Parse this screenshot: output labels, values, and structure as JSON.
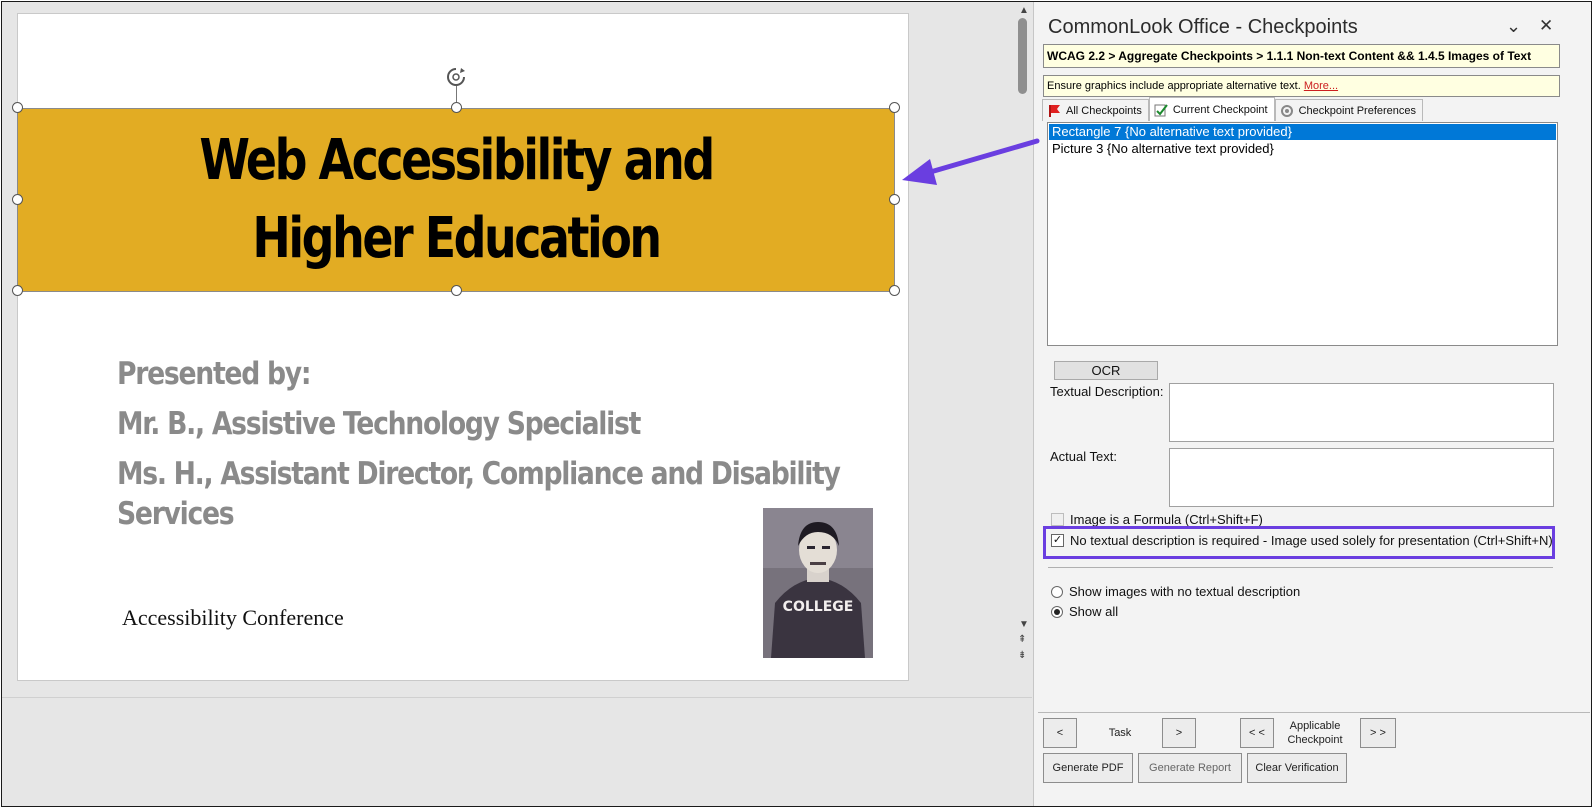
{
  "slide": {
    "title": "Web Accessibility and\nHigher Education",
    "presented_by": "Presented by:",
    "presenter_1": "Mr. B., Assistive Technology Specialist",
    "presenter_2": "Ms. H., Assistant Director, Compliance and Disability Services",
    "conference": "Accessibility Conference",
    "photo_caption": "COLLEGE"
  },
  "panel": {
    "title": "CommonLook Office - Checkpoints",
    "breadcrumb": "WCAG 2.2 > Aggregate Checkpoints > 1.1.1 Non-text Content && 1.4.5 Images of Text",
    "hint_text": "Ensure graphics include appropriate alternative text.",
    "hint_link": "More...",
    "tabs": [
      {
        "label": "All Checkpoints",
        "icon": "red-flag-icon"
      },
      {
        "label": "Current Checkpoint",
        "icon": "checkpoint-icon"
      },
      {
        "label": "Checkpoint Preferences",
        "icon": "preferences-icon"
      }
    ],
    "items": [
      "Rectangle 7 {No alternative text provided}",
      "Picture 3 {No alternative text provided}"
    ],
    "ocr_label": "OCR",
    "textual_description_label": "Textual Description:",
    "actual_text_label": "Actual Text:",
    "formula_label": "Image is a Formula (Ctrl+Shift+F)",
    "no_description_label": "No textual description is required - Image used solely for presentation (Ctrl+Shift+N)",
    "radio_no_desc": "Show images with no textual description",
    "radio_show_all": "Show all",
    "task_prev": "<",
    "task_label": "Task",
    "task_next": ">",
    "cp_prev": "< <",
    "cp_label_1": "Applicable",
    "cp_label_2": "Checkpoint",
    "cp_next": "> >",
    "generate_pdf": "Generate PDF",
    "generate_report": "Generate Report",
    "clear_verification": "Clear Verification"
  },
  "colors": {
    "title_fill": "#e2ac23",
    "selection_blue": "#0078d7",
    "annotation_purple": "#6a3ee0"
  }
}
